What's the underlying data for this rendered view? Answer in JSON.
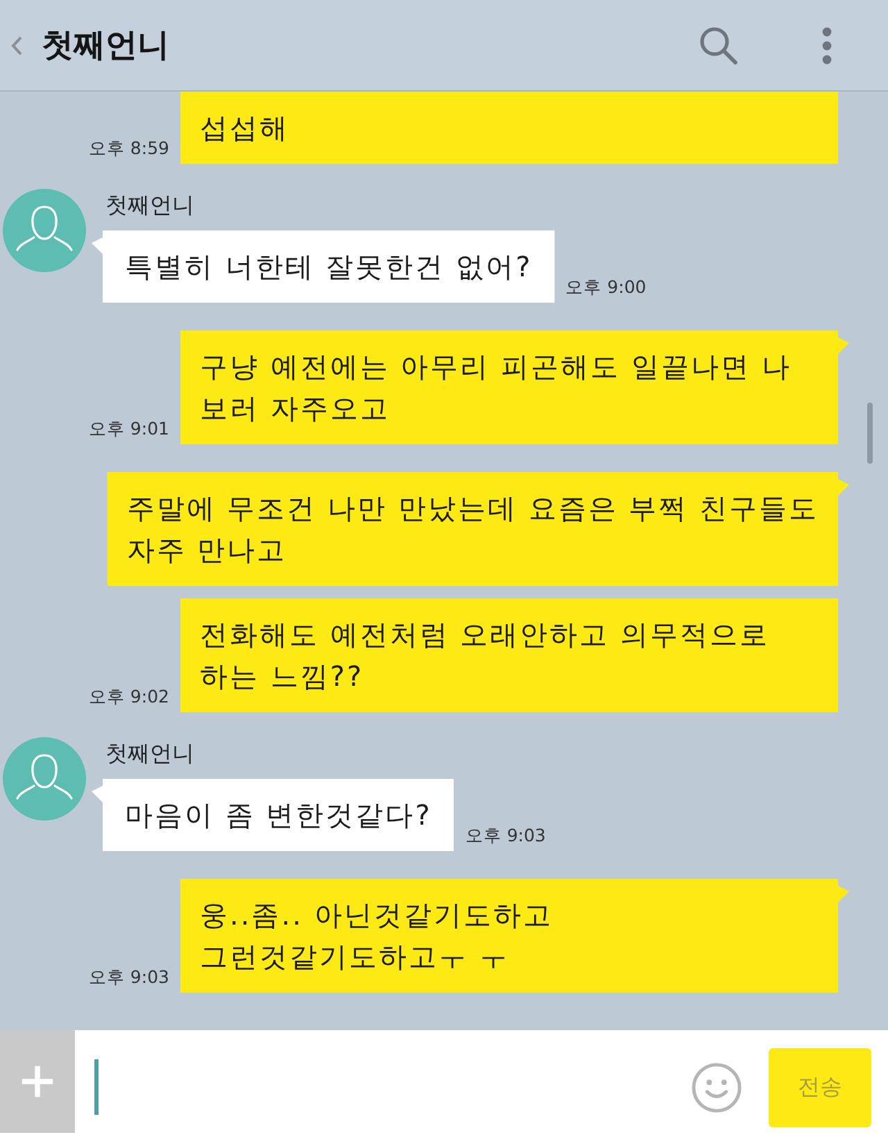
{
  "header": {
    "title": "첫째언니"
  },
  "messages": [
    {
      "kind": "sent",
      "text": "섭섭해",
      "time": "오후 8:59",
      "tail": false
    },
    {
      "kind": "received",
      "name": "첫째언니",
      "text": "특별히 너한테 잘못한건 없어?",
      "time": "오후 9:00",
      "tail": true
    },
    {
      "kind": "sent",
      "text": "구냥 예전에는 아무리 피곤해도 일끝나면 나\n보러 자주오고",
      "time": "오후 9:01",
      "tail": true
    },
    {
      "kind": "sent",
      "text": "주말에 무조건 나만 만났는데 요즘은 부쩍 친구들도\n자주 만나고",
      "tail": true
    },
    {
      "kind": "sent",
      "text": "전화해도 예전처럼 오래안하고 의무적으로\n하는 느낌??",
      "time": "오후 9:02",
      "tail": false
    },
    {
      "kind": "received",
      "name": "첫째언니",
      "text": "마음이 좀 변한것같다?",
      "time": "오후 9:03",
      "tail": true
    },
    {
      "kind": "sent",
      "text": "웅..좀.. 아닌것같기도하고\n그런것같기도하고ㅜ ㅜ",
      "time": "오후 9:03",
      "tail": true
    }
  ],
  "composer": {
    "send_button": {
      "label": "전송",
      "disabled": true
    }
  }
}
